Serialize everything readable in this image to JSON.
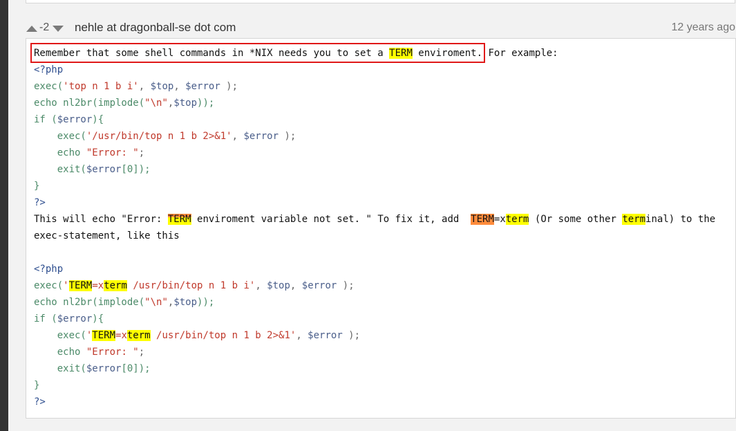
{
  "note": {
    "vote_count": "-2",
    "author": "nehle at dragonball-se dot com",
    "date": "12 years ago"
  },
  "body": {
    "intro_a": "Remember that some shell commands in *NIX needs you to set a ",
    "intro_hl": "TERM",
    "intro_b": " enviroment.",
    "intro_c": " For example:",
    "open_tag": "<?php",
    "l1_fn": "exec(",
    "l1_str": "'top n 1 b i'",
    "l1_sep1": ", ",
    "l1_var1": "$top",
    "l1_sep2": ", ",
    "l1_var2": "$error",
    "l1_end": " );",
    "l2_kw": "echo",
    "l2_fn": " nl2br(implode(",
    "l2_str": "\"\\n\"",
    "l2_sep": ",",
    "l2_var": "$top",
    "l2_end": "));",
    "l3_kw": "if",
    "l3_a": " (",
    "l3_var": "$error",
    "l3_b": "){",
    "l4_fn": "    exec(",
    "l4_str": "'/usr/bin/top n 1 b 2>&1'",
    "l4_sep": ", ",
    "l4_var": "$error",
    "l4_end": " );",
    "l5_kw": "    echo",
    "l5_sp": " ",
    "l5_str": "\"Error: \"",
    "l5_end": ";",
    "l6_kw": "    exit(",
    "l6_var": "$error",
    "l6_end": "[0]);",
    "close_brace": "}",
    "close_tag": "?>",
    "p2_a": "This will echo \"Error: ",
    "p2_hl1": "TERM",
    "p2_b": " enviroment variable not set. \" To fix it, add  ",
    "p2_hl2": "TERM",
    "p2_c": "=x",
    "p2_hl3": "term",
    "p2_d": " (Or some other ",
    "p2_hl4": "term",
    "p2_e": "inal) to the",
    "p3": "exec-statement, like this",
    "m1_fn": "exec(",
    "m1_q": "'",
    "m1_hl1": "TERM",
    "m1_eq": "=x",
    "m1_hl2": "term",
    "m1_str": " /usr/bin/top n 1 b i'",
    "m1_sep1": ", ",
    "m1_var1": "$top",
    "m1_sep2": ", ",
    "m1_var2": "$error",
    "m1_end": " );",
    "m4_fn": "    exec(",
    "m4_q": "'",
    "m4_hl1": "TERM",
    "m4_eq": "=x",
    "m4_hl2": "term",
    "m4_str": " /usr/bin/top n 1 b 2>&1'",
    "m4_sep": ", ",
    "m4_var": "$error",
    "m4_end": " );"
  },
  "colors": {
    "highlight": "#ffff00",
    "highlight_active": "#ff8c3c",
    "selection_border": "#e01818"
  }
}
